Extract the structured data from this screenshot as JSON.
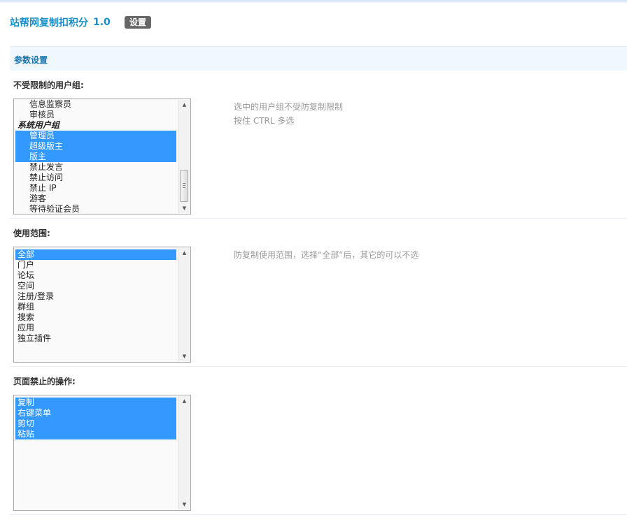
{
  "header": {
    "plugin_title": "站帮网复制扣积分",
    "version": "1.0",
    "settings_badge": "设置"
  },
  "section": {
    "title": "参数设置"
  },
  "fields": {
    "user_groups": {
      "label": "不受限制的用户组:",
      "options": [
        {
          "label": "信息监察员",
          "indent": true,
          "selected": false,
          "group": false
        },
        {
          "label": "审核员",
          "indent": true,
          "selected": false,
          "group": false
        },
        {
          "label": "系统用户组",
          "indent": false,
          "selected": false,
          "group": true
        },
        {
          "label": "管理员",
          "indent": true,
          "selected": true,
          "group": false
        },
        {
          "label": "超级版主",
          "indent": true,
          "selected": true,
          "group": false
        },
        {
          "label": "版主",
          "indent": true,
          "selected": true,
          "group": false
        },
        {
          "label": "禁止发言",
          "indent": true,
          "selected": false,
          "group": false
        },
        {
          "label": "禁止访问",
          "indent": true,
          "selected": false,
          "group": false
        },
        {
          "label": "禁止 IP",
          "indent": true,
          "selected": false,
          "group": false
        },
        {
          "label": "游客",
          "indent": true,
          "selected": false,
          "group": false
        },
        {
          "label": "等待验证会员",
          "indent": true,
          "selected": false,
          "group": false
        }
      ],
      "hint_lines": [
        "选中的用户组不受防复制限制",
        "按住 CTRL 多选"
      ]
    },
    "scope": {
      "label": "使用范围:",
      "options": [
        {
          "label": "全部",
          "indent": false,
          "selected": true,
          "group": false
        },
        {
          "label": "门户",
          "indent": false,
          "selected": false,
          "group": false
        },
        {
          "label": "论坛",
          "indent": false,
          "selected": false,
          "group": false
        },
        {
          "label": "空间",
          "indent": false,
          "selected": false,
          "group": false
        },
        {
          "label": "注册/登录",
          "indent": false,
          "selected": false,
          "group": false
        },
        {
          "label": "群组",
          "indent": false,
          "selected": false,
          "group": false
        },
        {
          "label": "搜索",
          "indent": false,
          "selected": false,
          "group": false
        },
        {
          "label": "应用",
          "indent": false,
          "selected": false,
          "group": false
        },
        {
          "label": "独立插件",
          "indent": false,
          "selected": false,
          "group": false
        }
      ],
      "hint_lines": [
        "防复制使用范围，选择“全部”后，其它的可以不选"
      ]
    },
    "forbidden_actions": {
      "label": "页面禁止的操作:",
      "options": [
        {
          "label": "复制",
          "indent": false,
          "selected": true,
          "group": false
        },
        {
          "label": "右键菜单",
          "indent": false,
          "selected": true,
          "group": false
        },
        {
          "label": "剪切",
          "indent": false,
          "selected": true,
          "group": false
        },
        {
          "label": "粘贴",
          "indent": false,
          "selected": true,
          "group": false
        }
      ],
      "hint_lines": []
    }
  },
  "scrollbar": {
    "up_arrow": "up-arrow-icon",
    "down_arrow": "down-arrow-icon"
  }
}
